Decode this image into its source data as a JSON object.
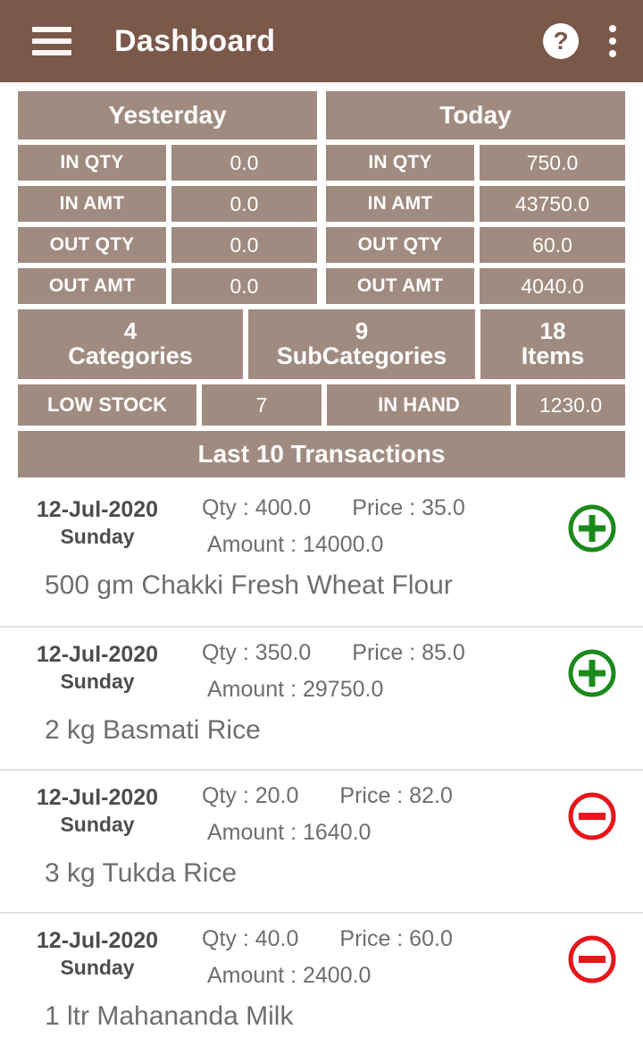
{
  "appbar": {
    "menu_icon": "hamburger-menu-icon",
    "title": "Dashboard",
    "help_icon": "help-question-icon",
    "help_label": "?",
    "overflow_icon": "overflow-menu-icon",
    "background_color": "#7a584a"
  },
  "theme": {
    "cell_color": "#a08b80",
    "in_color": "#1b8a1b",
    "out_color": "#e8151a",
    "text_color": "#6e6e6e"
  },
  "stats": {
    "yesterday": {
      "title": "Yesterday",
      "rows": [
        {
          "label": "IN QTY",
          "value": "0.0"
        },
        {
          "label": "IN AMT",
          "value": "0.0"
        },
        {
          "label": "OUT QTY",
          "value": "0.0"
        },
        {
          "label": "OUT AMT",
          "value": "0.0"
        }
      ]
    },
    "today": {
      "title": "Today",
      "rows": [
        {
          "label": "IN QTY",
          "value": "750.0"
        },
        {
          "label": "IN AMT",
          "value": "43750.0"
        },
        {
          "label": "OUT QTY",
          "value": "60.0"
        },
        {
          "label": "OUT AMT",
          "value": "4040.0"
        }
      ]
    },
    "counts": [
      {
        "count": "4",
        "label": "Categories"
      },
      {
        "count": "9",
        "label": "SubCategories"
      },
      {
        "count": "18",
        "label": "Items"
      }
    ],
    "low_stock": {
      "label": "LOW STOCK",
      "value": "7"
    },
    "in_hand": {
      "label": "IN HAND",
      "value": "1230.0"
    }
  },
  "transactions": {
    "header": "Last 10 Transactions",
    "qty_prefix": "Qty : ",
    "price_prefix": "Price : ",
    "amount_prefix": "Amount : ",
    "items": [
      {
        "date": "12-Jul-2020",
        "day": "Sunday",
        "qty": "Qty : 400.0",
        "price": "Price : 35.0",
        "amount": "Amount : 14000.0",
        "name": "500 gm Chakki Fresh Wheat Flour",
        "type": "in"
      },
      {
        "date": "12-Jul-2020",
        "day": "Sunday",
        "qty": "Qty : 350.0",
        "price": "Price : 85.0",
        "amount": "Amount : 29750.0",
        "name": "2 kg Basmati Rice",
        "type": "in"
      },
      {
        "date": "12-Jul-2020",
        "day": "Sunday",
        "qty": "Qty : 20.0",
        "price": "Price : 82.0",
        "amount": "Amount : 1640.0",
        "name": "3 kg Tukda Rice",
        "type": "out"
      },
      {
        "date": "12-Jul-2020",
        "day": "Sunday",
        "qty": "Qty : 40.0",
        "price": "Price : 60.0",
        "amount": "Amount : 2400.0",
        "name": "1 ltr Mahananda Milk",
        "type": "out"
      }
    ]
  }
}
